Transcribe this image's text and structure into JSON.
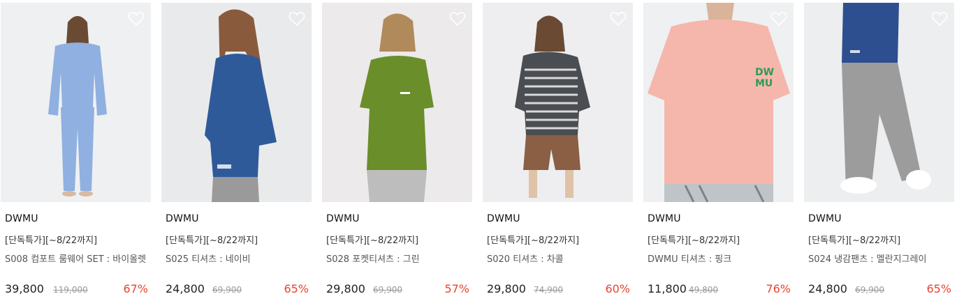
{
  "products": [
    {
      "brand": "DWMU",
      "promo": "[단독특가][~8/22까지]",
      "name": "S008 컴포트 룸웨어 SET : 바이올렛",
      "price": "39,800",
      "original_price": "119,000",
      "discount": "67%",
      "garment_color": "#8fb0e0",
      "bottom_color": "#8fb0e0",
      "bg_color": "#eef0f2",
      "wishlist_icon": "heart-outline-icon"
    },
    {
      "brand": "DWMU",
      "promo": "[단독특가][~8/22까지]",
      "name": "S025 티셔츠 : 네이비",
      "price": "24,800",
      "original_price": "69,900",
      "discount": "65%",
      "garment_color": "#2e5a99",
      "bottom_color": "#9a9a9a",
      "bg_color": "#e9eaec",
      "wishlist_icon": "heart-outline-icon"
    },
    {
      "brand": "DWMU",
      "promo": "[단독특가][~8/22까지]",
      "name": "S028 포켓티셔츠 : 그린",
      "price": "29,800",
      "original_price": "69,900",
      "discount": "57%",
      "garment_color": "#6a8e2a",
      "bottom_color": "#bdbdbd",
      "bg_color": "#eceaea",
      "wishlist_icon": "heart-outline-icon"
    },
    {
      "brand": "DWMU",
      "promo": "[단독특가][~8/22까지]",
      "name": "S020 티셔츠 : 차콜",
      "price": "29,800",
      "original_price": "74,900",
      "discount": "60%",
      "garment_color": "#4a4d52",
      "bottom_color": "#8a5f44",
      "bg_color": "#eeeef0",
      "wishlist_icon": "heart-outline-icon"
    },
    {
      "brand": "DWMU",
      "promo": "[단독특가][~8/22까지]",
      "name": "DWMU 티셔츠 : 핑크",
      "price": "11,800",
      "original_price": "49,800",
      "discount": "76%",
      "garment_color": "#f5b7ab",
      "bottom_color": "#bfc4c8",
      "bg_color": "#eef0f2",
      "wishlist_icon": "heart-outline-icon"
    },
    {
      "brand": "DWMU",
      "promo": "[단독특가][~8/22까지]",
      "name": "S024 냉감팬츠 : 멜란지그레이",
      "price": "24,800",
      "original_price": "69,900",
      "discount": "65%",
      "garment_color": "#2e4f8f",
      "bottom_color": "#9c9c9c",
      "bg_color": "#eceeef",
      "wishlist_icon": "heart-outline-icon"
    }
  ],
  "colors": {
    "discount": "#e8442f",
    "original_price": "#999999"
  }
}
